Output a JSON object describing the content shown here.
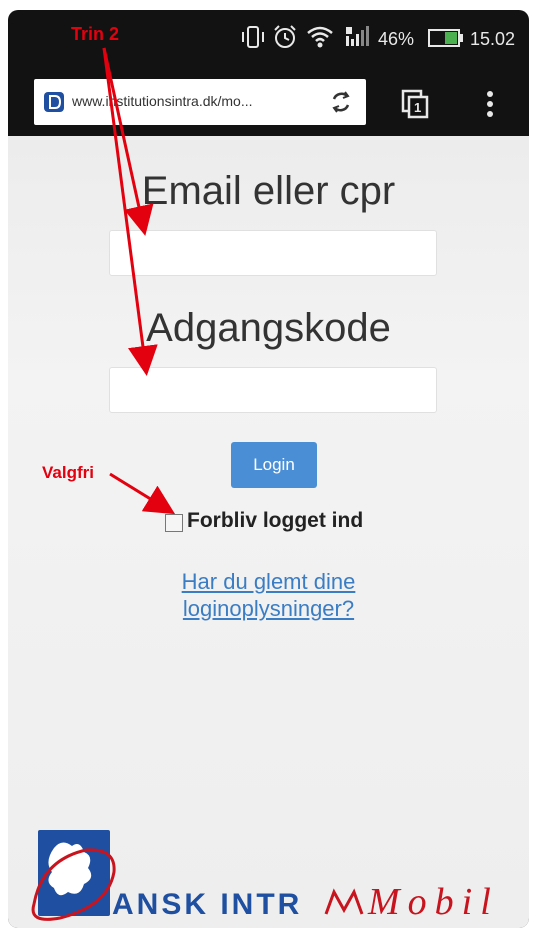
{
  "status_bar": {
    "battery_percent": "46%",
    "time": "15.02",
    "icons": [
      "vibrate-icon",
      "alarm-icon",
      "wifi-icon",
      "signal-icon",
      "battery-icon"
    ]
  },
  "browser": {
    "url": "www.institutionsintra.dk/mo...",
    "icons": [
      "site-favicon",
      "reload-icon",
      "tabs-icon",
      "overflow-menu-icon"
    ],
    "tab_count": "1"
  },
  "login_form": {
    "email_label": "Email eller cpr",
    "email_value": "",
    "password_label": "Adgangskode",
    "password_value": "",
    "login_button": "Login",
    "remember_label": "Forbliv logget ind",
    "remember_checked": false,
    "forgot_link_line1": "Har du glemt dine",
    "forgot_link_line2": "loginoplysninger?"
  },
  "logo": {
    "text_part1": "ANSK INTR",
    "text_part2": "Mobil"
  },
  "annotations": {
    "step_label": "Trin 2",
    "optional_label": "Valgfri",
    "color": "#e3000f"
  },
  "colors": {
    "button_blue": "#4a8fd6",
    "link_blue": "#3b7dc4",
    "logo_blue": "#1f4fa0"
  }
}
